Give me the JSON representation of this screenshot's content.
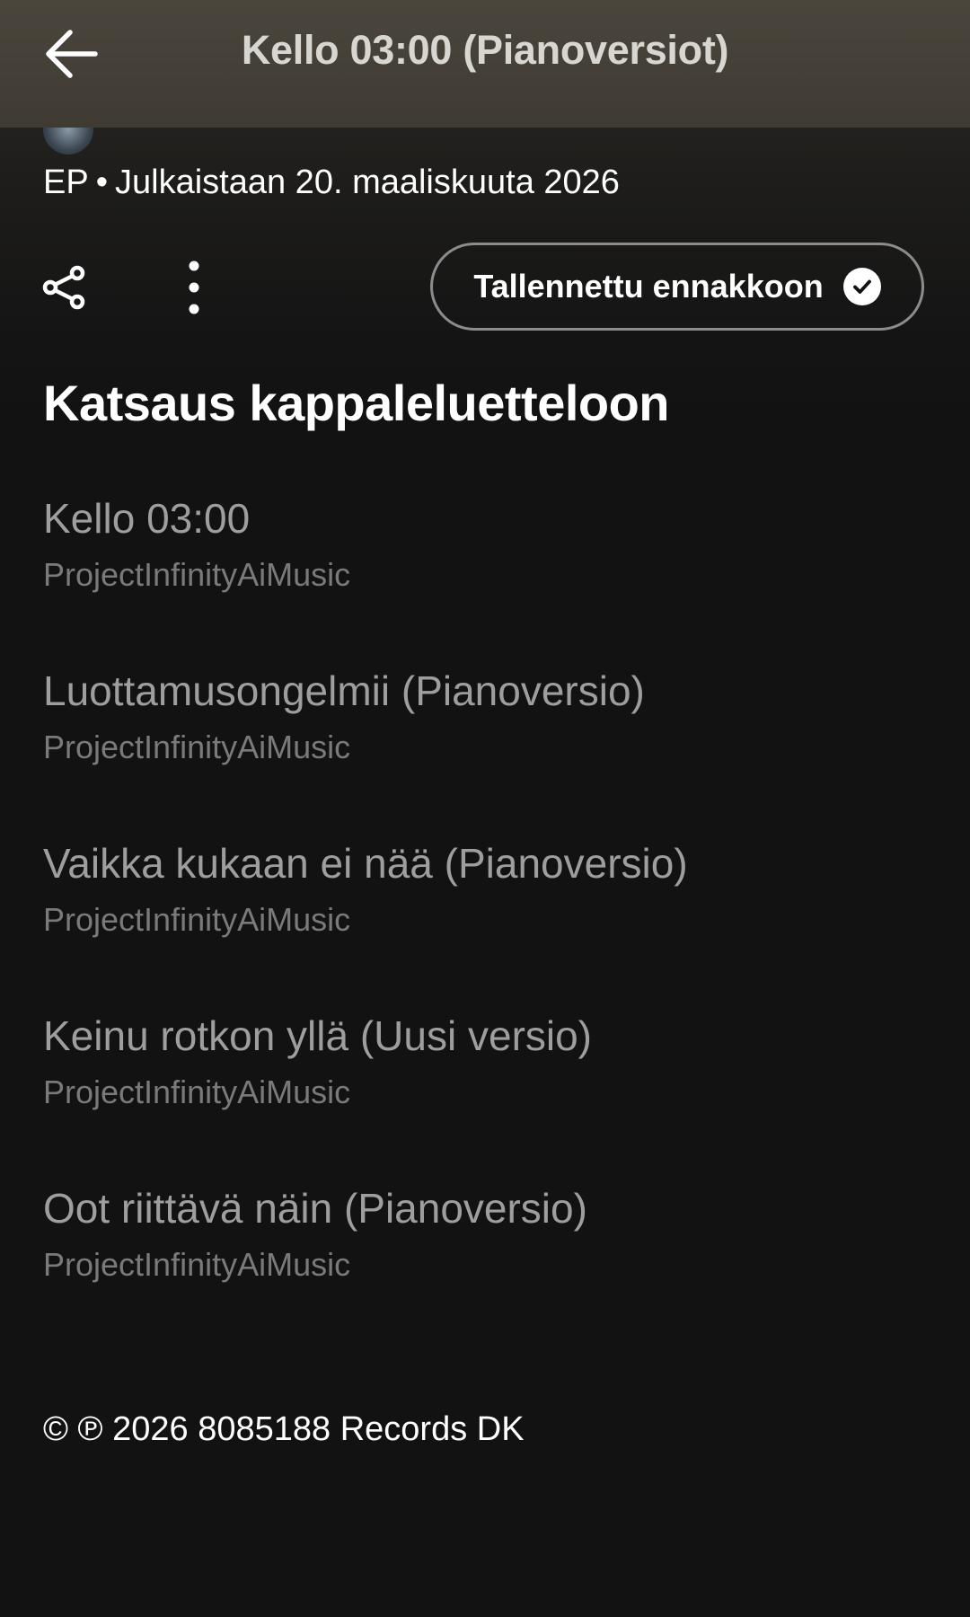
{
  "header": {
    "title": "Kello 03:00 (Pianoversiot)",
    "back_icon": "arrow-left-icon"
  },
  "release": {
    "type": "EP",
    "separator": "•",
    "release_info": "Julkaistaan 20. maaliskuuta 2026"
  },
  "actions": {
    "share_icon": "share-icon",
    "more_icon": "more-vertical-icon",
    "presave_label": "Tallennettu ennakkoon",
    "presave_icon": "check-circle-icon"
  },
  "tracklist": {
    "heading": "Katsaus kappaleluetteloon",
    "tracks": [
      {
        "title": "Kello 03:00",
        "artist": "ProjectInfinityAiMusic"
      },
      {
        "title": "Luottamusongelmii (Pianoversio)",
        "artist": "ProjectInfinityAiMusic"
      },
      {
        "title": "Vaikka kukaan ei nää (Pianoversio)",
        "artist": "ProjectInfinityAiMusic"
      },
      {
        "title": "Keinu rotkon yllä (Uusi versio)",
        "artist": "ProjectInfinityAiMusic"
      },
      {
        "title": "Oot riittävä näin (Pianoversio)",
        "artist": "ProjectInfinityAiMusic"
      }
    ]
  },
  "footer": {
    "copyright": "© ℗ 2026 8085188 Records DK"
  },
  "colors": {
    "background": "#121212",
    "header_bg": "#4a463d",
    "track_title": "#9e9e9e",
    "track_artist": "#7a7a7a"
  }
}
